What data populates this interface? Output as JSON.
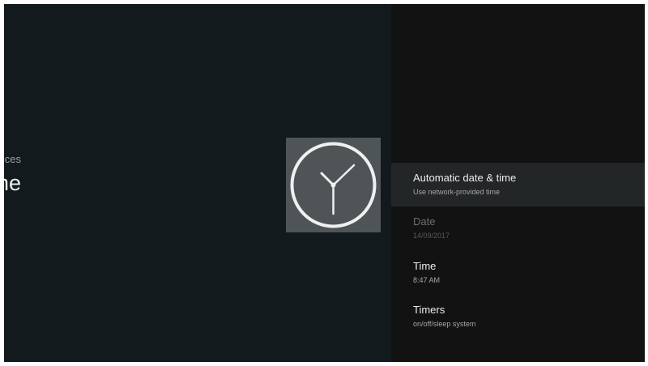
{
  "header": {
    "breadcrumb": "Preferences",
    "title": "Date & Time",
    "icon": "clock-icon"
  },
  "menu": {
    "items": [
      {
        "title": "Automatic date & time",
        "subtitle": "Use network-provided time",
        "state": "focused"
      },
      {
        "title": "Date",
        "subtitle": "14/09/2017",
        "state": "disabled"
      },
      {
        "title": "Time",
        "subtitle": "8:47 AM",
        "state": "normal"
      },
      {
        "title": "Timers",
        "subtitle": "on/off/sleep system",
        "state": "normal"
      }
    ]
  },
  "colors": {
    "background_left": "#131a1e",
    "background_right": "#121212",
    "focus_highlight": "#232627",
    "icon_tile": "#4f5457"
  }
}
